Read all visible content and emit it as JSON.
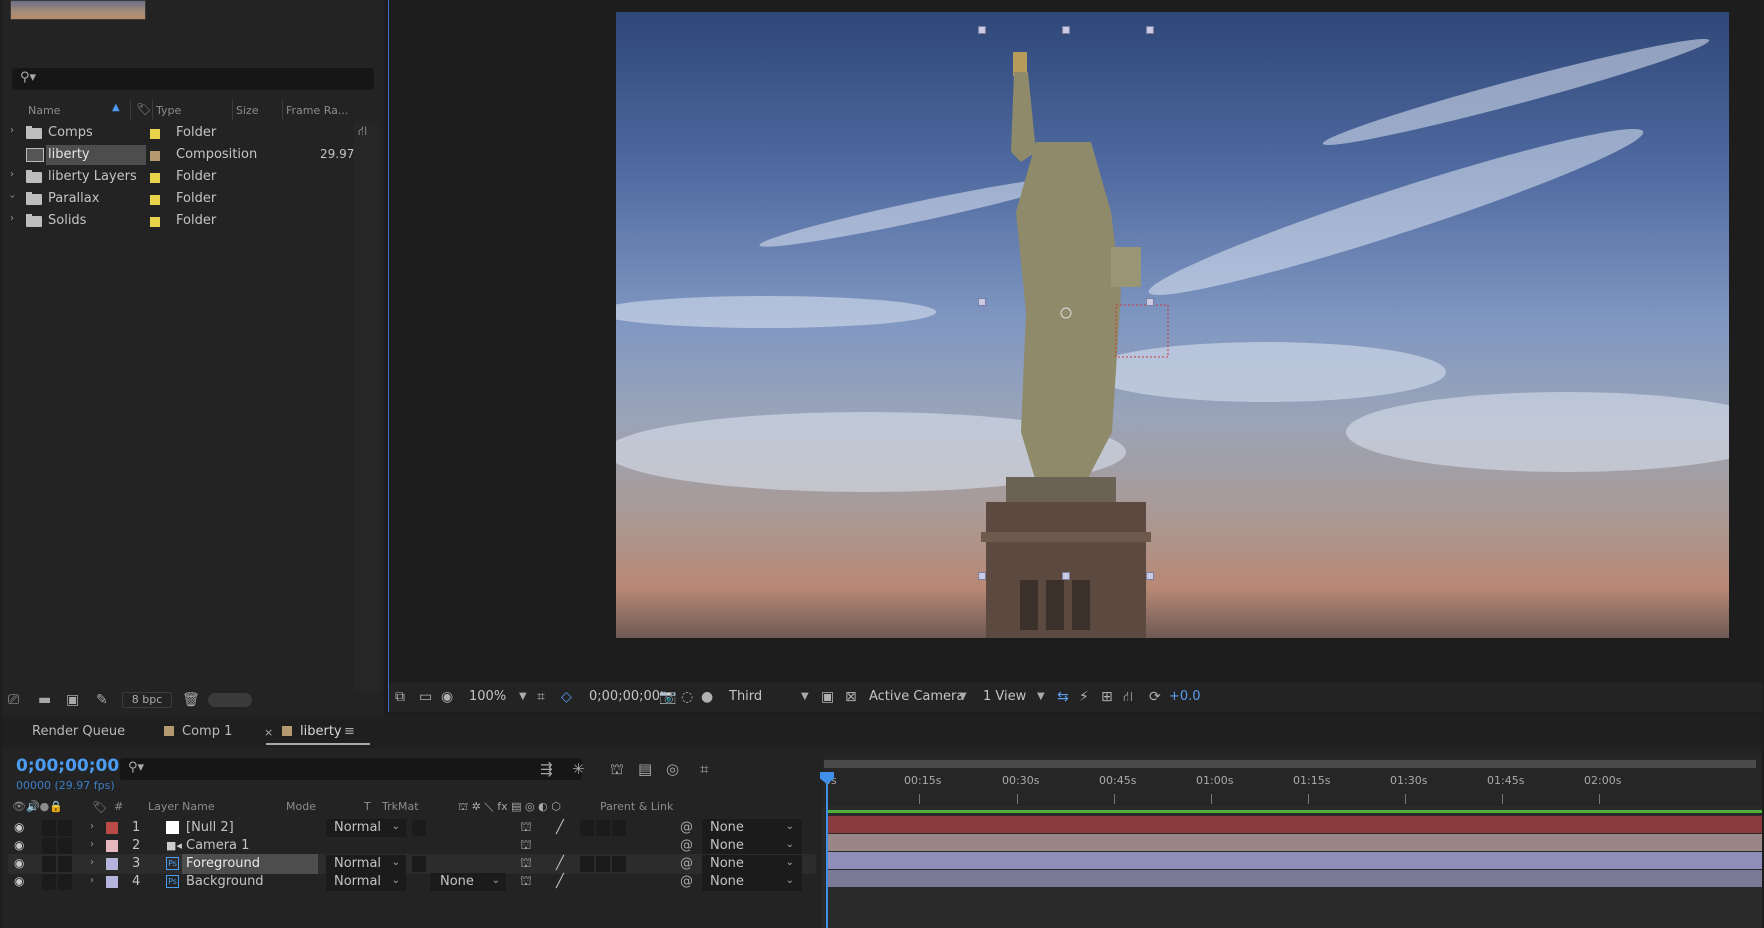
{
  "project": {
    "search_icon": "⚲▾",
    "columns": {
      "name": "Name",
      "type": "Type",
      "size": "Size",
      "frame_rate": "Frame Ra..."
    },
    "items": [
      {
        "name": "Comps",
        "type": "Folder",
        "icon": "folder-icon",
        "label_color": "#e8d44a",
        "frame_rate": "",
        "expanded": false
      },
      {
        "name": "liberty",
        "type": "Composition",
        "icon": "composition-icon",
        "label_color": "#b49a6e",
        "frame_rate": "29.97",
        "selected": true
      },
      {
        "name": "liberty Layers",
        "type": "Folder",
        "icon": "folder-icon",
        "label_color": "#e8d44a",
        "frame_rate": "",
        "expanded": false
      },
      {
        "name": "Parallax",
        "type": "Folder",
        "icon": "folder-icon",
        "label_color": "#e8d44a",
        "frame_rate": "",
        "expanded": true
      },
      {
        "name": "Solids",
        "type": "Folder",
        "icon": "folder-icon",
        "label_color": "#e8d44a",
        "frame_rate": "",
        "expanded": false
      }
    ],
    "footer": {
      "bpc": "8 bpc"
    }
  },
  "viewer": {
    "zoom": "100%",
    "timecode": "0;00;00;00",
    "resolution": "Third",
    "camera": "Active Camera",
    "views": "1 View",
    "exposure": "+0.0"
  },
  "timeline": {
    "tabs": [
      {
        "label": "Render Queue",
        "active": false
      },
      {
        "label": "Comp 1",
        "active": false,
        "color": "#b49a6e"
      },
      {
        "label": "liberty",
        "active": true,
        "color": "#b49a6e",
        "close": "×"
      }
    ],
    "timecode": "0;00;00;00",
    "fps": "00000 (29.97 fps)",
    "columns": {
      "num": "#",
      "layer_name": "Layer Name",
      "mode": "Mode",
      "t": "T",
      "trkmat": "TrkMat",
      "parent": "Parent & Link"
    },
    "layers": [
      {
        "num": "1",
        "name": "[Null 2]",
        "label_color": "#b94a48",
        "icon": "null-icon",
        "mode": "Normal",
        "trkmat": "",
        "parent": "None",
        "bar_color": "#8a3c3c"
      },
      {
        "num": "2",
        "name": "Camera 1",
        "label_color": "#e6b6bf",
        "icon": "camera-icon",
        "mode": "",
        "trkmat": "",
        "parent": "None",
        "bar_color": "#9a8686"
      },
      {
        "num": "3",
        "name": "Foreground",
        "label_color": "#b4b4dc",
        "icon": "footage-icon",
        "mode": "Normal",
        "trkmat": "",
        "parent": "None",
        "bar_color": "#8e8eb8",
        "selected": true
      },
      {
        "num": "4",
        "name": "Background",
        "label_color": "#b4b4dc",
        "icon": "footage-icon",
        "mode": "Normal",
        "trkmat": "None",
        "parent": "None",
        "bar_color": "#7a7a96"
      }
    ],
    "ruler": [
      "0s",
      "00:15s",
      "00:30s",
      "00:45s",
      "01:00s",
      "01:15s",
      "01:30s",
      "01:45s",
      "02:00s"
    ]
  }
}
